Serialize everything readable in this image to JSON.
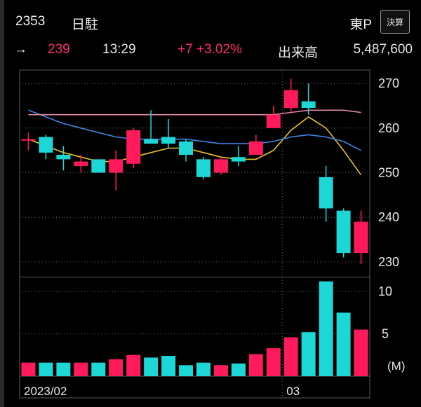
{
  "header": {
    "code": "2353",
    "name": "日駐",
    "market": "東P",
    "kessan_label": "決算"
  },
  "quote": {
    "arrow": "→",
    "price": "239",
    "time": "13:29",
    "change": "+7 +3.02%",
    "volume_label": "出来高",
    "volume": "5,487,600"
  },
  "colors": {
    "up": "#ff1a5c",
    "down": "#1ed6d6",
    "ma_short": "#e8c420",
    "ma_mid": "#3f86e6",
    "ma_long": "#e68aa6"
  },
  "chart_data": {
    "type": "candlestick",
    "x_labels": [
      {
        "index": 0,
        "label": "2023/02"
      },
      {
        "index": 15,
        "label": "03"
      }
    ],
    "price_axis": {
      "ticks": [
        230,
        240,
        250,
        260,
        270
      ],
      "ylim": [
        227,
        273
      ]
    },
    "volume_axis": {
      "ticks": [
        5,
        10
      ],
      "unit": "(M)",
      "ylim": [
        0,
        11.5
      ]
    },
    "candles": [
      {
        "open": 257.5,
        "high": 259,
        "low": 255,
        "close": 257.5,
        "volume": 1.6
      },
      {
        "open": 258,
        "high": 258.5,
        "low": 253,
        "close": 254.5,
        "volume": 1.6
      },
      {
        "open": 254,
        "high": 256,
        "low": 250.5,
        "close": 253,
        "volume": 1.6
      },
      {
        "open": 251.5,
        "high": 254,
        "low": 250,
        "close": 252.5,
        "volume": 1.6
      },
      {
        "open": 253,
        "high": 253,
        "low": 250,
        "close": 250,
        "volume": 1.6
      },
      {
        "open": 250,
        "high": 255,
        "low": 246,
        "close": 253,
        "volume": 2.0
      },
      {
        "open": 252,
        "high": 260,
        "low": 251,
        "close": 259.5,
        "volume": 2.5
      },
      {
        "open": 257.5,
        "high": 264,
        "low": 256.5,
        "close": 256.5,
        "volume": 2.2
      },
      {
        "open": 258,
        "high": 262,
        "low": 255.5,
        "close": 256.5,
        "volume": 2.4
      },
      {
        "open": 257,
        "high": 257.5,
        "low": 252.5,
        "close": 254,
        "volume": 1.3
      },
      {
        "open": 253,
        "high": 253.5,
        "low": 248.5,
        "close": 249,
        "volume": 1.6
      },
      {
        "open": 250,
        "high": 253.5,
        "low": 249.5,
        "close": 253,
        "volume": 1.3
      },
      {
        "open": 253.5,
        "high": 256,
        "low": 251.5,
        "close": 252.5,
        "volume": 1.5
      },
      {
        "open": 254,
        "high": 258.5,
        "low": 254,
        "close": 257,
        "volume": 2.6
      },
      {
        "open": 260,
        "high": 265,
        "low": 260,
        "close": 263,
        "volume": 3.3
      },
      {
        "open": 264.5,
        "high": 271,
        "low": 263.5,
        "close": 268.5,
        "volume": 4.6
      },
      {
        "open": 266,
        "high": 270,
        "low": 263,
        "close": 264.5,
        "volume": 5.2
      },
      {
        "open": 249,
        "high": 251.5,
        "low": 239,
        "close": 242,
        "volume": 11.2
      },
      {
        "open": 241.5,
        "high": 242,
        "low": 231,
        "close": 232,
        "volume": 7.5
      },
      {
        "open": 232,
        "high": 241.5,
        "low": 229.5,
        "close": 239,
        "volume": 5.5
      }
    ],
    "moving_averages": [
      {
        "name": "short",
        "values": [
          257.5,
          256,
          254.5,
          253.5,
          252.5,
          252.5,
          253.5,
          254.5,
          255.5,
          255.5,
          254.5,
          253.5,
          253,
          253,
          255,
          259.5,
          262.5,
          260,
          255,
          249.5
        ]
      },
      {
        "name": "mid",
        "values": [
          264,
          262.5,
          261,
          260,
          259,
          258,
          257.5,
          257.5,
          257.5,
          257.5,
          257,
          256.5,
          256.5,
          256.5,
          257,
          258,
          258.5,
          258,
          257,
          255
        ]
      },
      {
        "name": "long",
        "values": [
          263,
          263,
          263,
          263,
          263,
          263,
          263,
          263,
          263,
          263,
          263,
          263,
          263,
          263,
          263,
          263.5,
          264,
          264,
          264,
          263.5
        ]
      }
    ]
  }
}
